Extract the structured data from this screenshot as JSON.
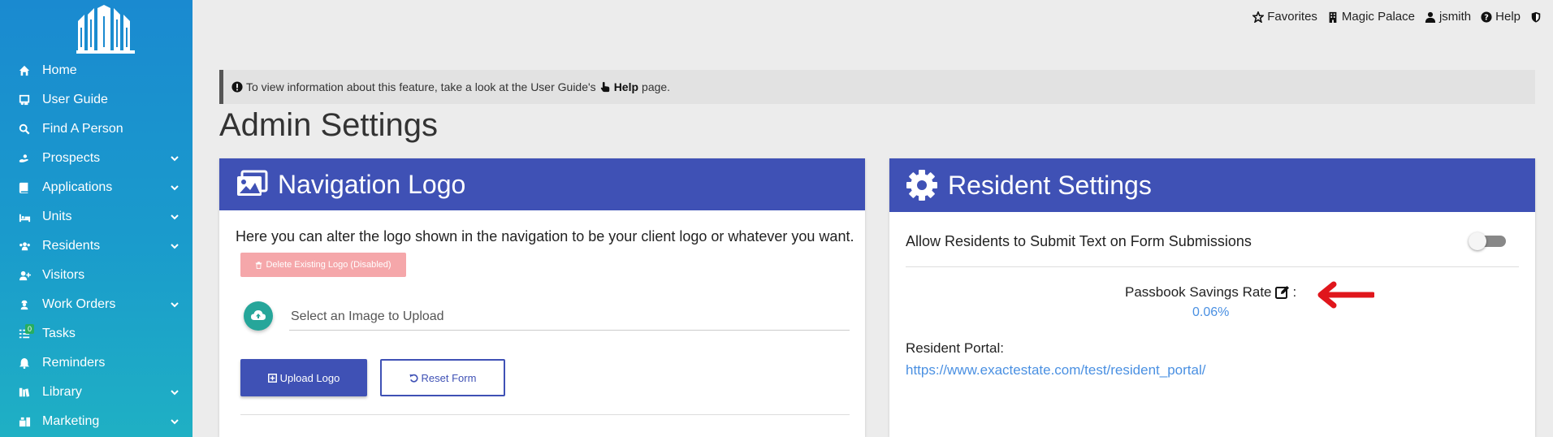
{
  "sidebar": {
    "items": [
      {
        "label": "Home",
        "icon": "home-icon",
        "has_submenu": false
      },
      {
        "label": "User Guide",
        "icon": "user-guide-icon",
        "has_submenu": false
      },
      {
        "label": "Find A Person",
        "icon": "search-icon",
        "has_submenu": false
      },
      {
        "label": "Prospects",
        "icon": "prospects-icon",
        "has_submenu": true
      },
      {
        "label": "Applications",
        "icon": "book-icon",
        "has_submenu": true
      },
      {
        "label": "Units",
        "icon": "bed-icon",
        "has_submenu": true
      },
      {
        "label": "Residents",
        "icon": "users-icon",
        "has_submenu": true
      },
      {
        "label": "Visitors",
        "icon": "user-plus-icon",
        "has_submenu": false
      },
      {
        "label": "Work Orders",
        "icon": "worker-icon",
        "has_submenu": true
      },
      {
        "label": "Tasks",
        "icon": "tasks-icon",
        "has_submenu": false,
        "badge": "0"
      },
      {
        "label": "Reminders",
        "icon": "bell-icon",
        "has_submenu": false
      },
      {
        "label": "Library",
        "icon": "library-icon",
        "has_submenu": true
      },
      {
        "label": "Marketing",
        "icon": "marketing-icon",
        "has_submenu": true
      }
    ]
  },
  "topnav": {
    "favorites": "Favorites",
    "property": "Magic Palace",
    "user": "jsmith",
    "help": "Help"
  },
  "banner": {
    "text_before": "To view information about this feature, take a look at the User Guide's",
    "help_link": "Help",
    "text_after": "page."
  },
  "page": {
    "title": "Admin Settings"
  },
  "navigation_logo_card": {
    "title": "Navigation Logo",
    "description": "Here you can alter the logo shown in the navigation to be your client logo or whatever you want.",
    "delete_button": "Delete Existing Logo (Disabled)",
    "file_placeholder": "Select an Image to Upload",
    "upload_button": "Upload Logo",
    "reset_button": "Reset Form"
  },
  "resident_settings_card": {
    "title": "Resident Settings",
    "toggle_label": "Allow Residents to Submit Text on Form Submissions",
    "toggle_on": false,
    "passbook_label": "Passbook Savings Rate",
    "passbook_suffix": ":",
    "passbook_value": "0.06%",
    "portal_label": "Resident Portal:",
    "portal_url": "https://www.exactestate.com/test/resident_portal/"
  },
  "colors": {
    "primary": "#3f51b5",
    "sidebar_top": "#1a8ad0",
    "link": "#4a90e2",
    "danger_disabled": "#f5a7aa",
    "teal": "#26a69a",
    "annotation_arrow": "#e0161c"
  }
}
